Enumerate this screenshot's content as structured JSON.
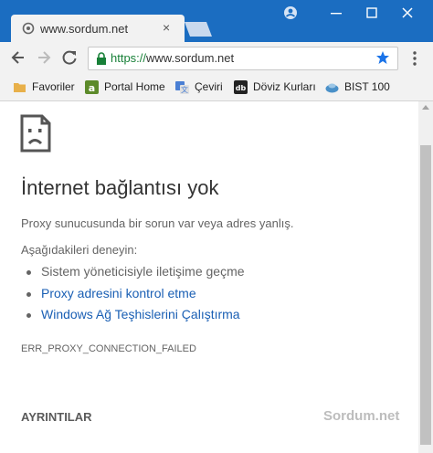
{
  "window": {
    "tab_title": "www.sordum.net",
    "tab_close_glyph": "×",
    "controls": [
      "user-icon",
      "minimize-icon",
      "maximize-icon",
      "close-icon"
    ]
  },
  "toolbar": {
    "url_scheme": "https://",
    "url_host": "www.sordum.net"
  },
  "bookmarks": [
    {
      "label": "Favoriler",
      "icon": "folder-icon",
      "color": "#e8b04a"
    },
    {
      "label": "Portal Home",
      "icon": "portal-home-icon",
      "color": "#5c8a2a"
    },
    {
      "label": "Çeviri",
      "icon": "translate-icon",
      "color": "#4a7fd4"
    },
    {
      "label": "Döviz Kurları",
      "icon": "currency-icon",
      "color": "#222222"
    },
    {
      "label": "BIST 100",
      "icon": "bist-icon",
      "color": "#4a90c8"
    }
  ],
  "error": {
    "title": "İnternet bağlantısı yok",
    "description": "Proxy sunucusunda bir sorun var veya adres yanlış.",
    "suggestions_heading": "Aşağıdakileri deneyin:",
    "suggestions": [
      {
        "text": "Sistem yöneticisiyle iletişime geçme",
        "link": false
      },
      {
        "text": "Proxy adresini kontrol etme",
        "link": true
      },
      {
        "text": "Windows Ağ Teşhislerini Çalıştırma",
        "link": true
      }
    ],
    "code": "ERR_PROXY_CONNECTION_FAILED",
    "details_label": "AYRINTILAR"
  },
  "watermark": "Sordum.net",
  "colors": {
    "titlebar": "#1b6dc1",
    "secure_green": "#188038",
    "link_blue": "#1a5fb4",
    "star_blue": "#1a73e8"
  }
}
